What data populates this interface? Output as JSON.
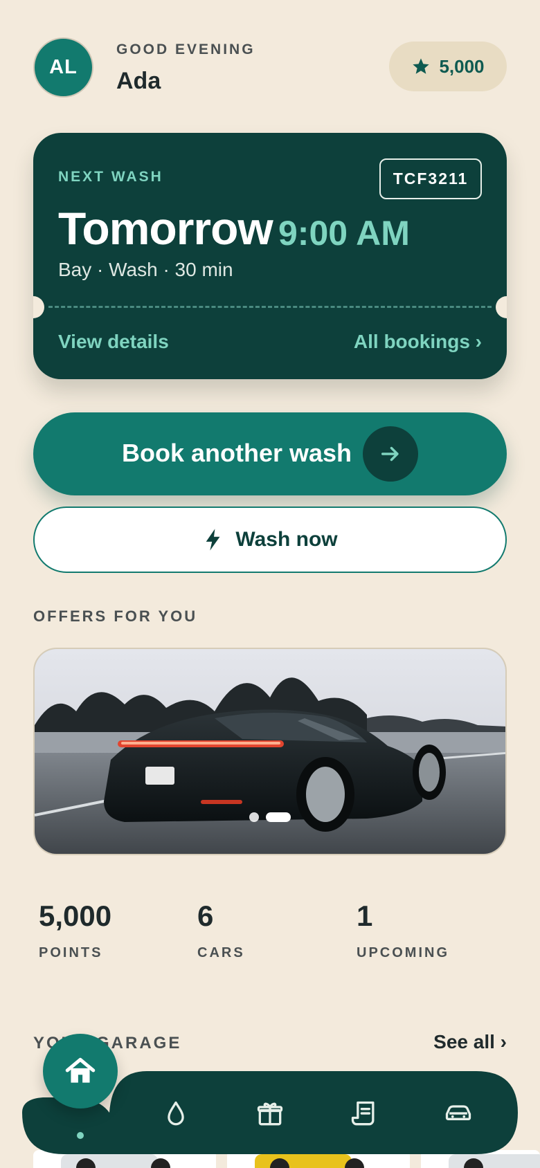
{
  "header": {
    "avatar_initials": "AL",
    "greeting": "GOOD EVENING",
    "user_name": "Ada",
    "points_chip": "5,000"
  },
  "next_wash": {
    "label": "NEXT WASH",
    "plate": "TCF3211",
    "day": "Tomorrow",
    "time": "9:00 AM",
    "meta": "Bay · Wash · 30 min",
    "view_details": "View details",
    "all_bookings": "All bookings ›"
  },
  "actions": {
    "book_label": "Book another wash",
    "wash_now_label": "Wash now"
  },
  "offers": {
    "title": "OFFERS FOR YOU",
    "slides_total": 2,
    "active_slide": 2
  },
  "stats": [
    {
      "value": "5,000",
      "label": "POINTS"
    },
    {
      "value": "6",
      "label": "CARS"
    },
    {
      "value": "1",
      "label": "UPCOMING"
    }
  ],
  "garage": {
    "title": "YOUR GARAGE",
    "see_all": "See all ›"
  },
  "bottom_nav": {
    "active": "home",
    "items": [
      "home-icon",
      "drop-icon",
      "gift-icon",
      "receipt-icon",
      "car-icon"
    ]
  },
  "colors": {
    "background": "#f3eadc",
    "primary": "#127a6e",
    "dark": "#0d403b",
    "accent": "#7fd4c0"
  }
}
